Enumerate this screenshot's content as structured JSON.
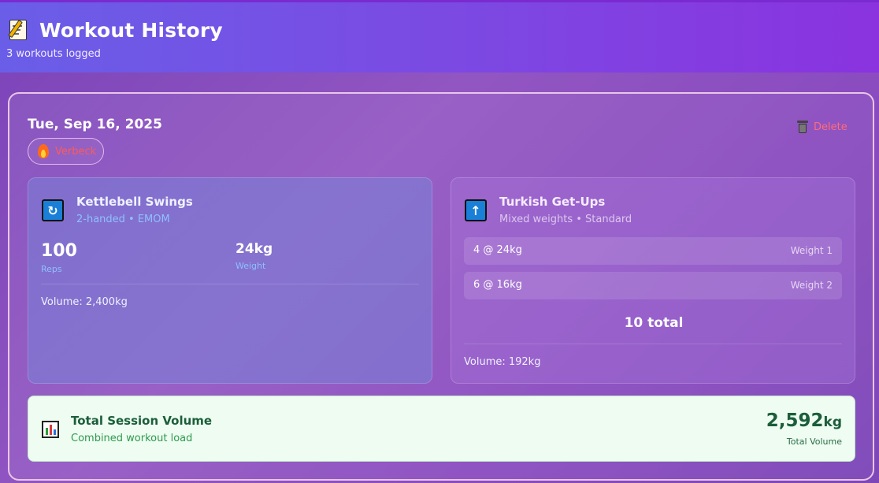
{
  "header": {
    "icon": "memo-icon",
    "title": "Workout History",
    "subtitle": "3 workouts logged"
  },
  "session": {
    "date": "Tue, Sep 16, 2025",
    "badge": {
      "icon": "fire-icon",
      "label": "Verbeck"
    },
    "delete": {
      "icon": "trash-icon",
      "label": "Delete"
    }
  },
  "exercises": [
    {
      "icon": "repeat-icon",
      "name": "Kettlebell Swings",
      "details": "2-handed • EMOM",
      "reps_value": "100",
      "reps_label": "Reps",
      "weight_value": "24kg",
      "weight_label": "Weight",
      "volume": "Volume: 2,400kg"
    },
    {
      "icon": "up-arrow-icon",
      "name": "Turkish Get-Ups",
      "details": "Mixed weights • Standard",
      "weights": [
        {
          "value": "4 @ 24kg",
          "label": "Weight 1"
        },
        {
          "value": "6 @ 16kg",
          "label": "Weight 2"
        }
      ],
      "total": "10 total",
      "volume": "Volume: 192kg"
    }
  ],
  "summary": {
    "icon": "bar-chart-icon",
    "title": "Total Session Volume",
    "subtitle": "Combined workout load",
    "value": "2,592",
    "unit": "kg",
    "label": "Total Volume"
  },
  "colors": {
    "header_start": "#6a5ee8",
    "header_end": "#8a33df",
    "badge_text": "#ff5a5a",
    "delete_text": "#ff6b7a",
    "summary_bg": "#eefcf1",
    "summary_text": "#1b5e3a"
  }
}
